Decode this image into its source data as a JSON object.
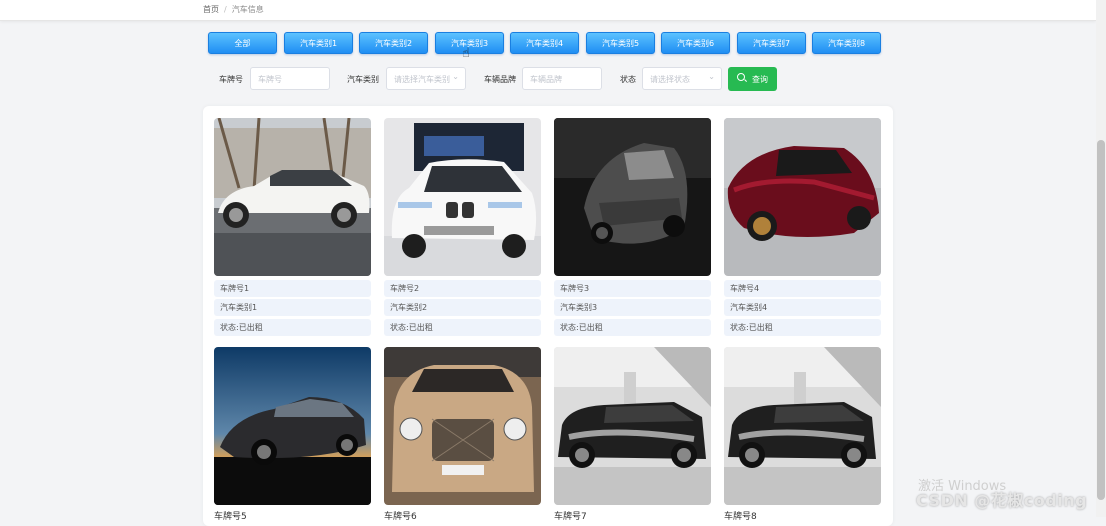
{
  "breadcrumb": {
    "home": "首页",
    "current": "汽车信息"
  },
  "tabs": [
    "全部",
    "汽车类别1",
    "汽车类别2",
    "汽车类别3",
    "汽车类别4",
    "汽车类别5",
    "汽车类别6",
    "汽车类别7",
    "汽车类别8"
  ],
  "filters": {
    "plate_label": "车牌号",
    "plate_placeholder": "车牌号",
    "category_label": "汽车类别",
    "category_placeholder": "请选择汽车类别",
    "brand_label": "车辆品牌",
    "brand_placeholder": "车辆品牌",
    "status_label": "状态",
    "status_placeholder": "请选择状态",
    "search_label": "查询"
  },
  "cars": [
    {
      "plate": "车牌号1",
      "category": "汽车类别1",
      "status": "状态:已出租"
    },
    {
      "plate": "车牌号2",
      "category": "汽车类别2",
      "status": "状态:已出租"
    },
    {
      "plate": "车牌号3",
      "category": "汽车类别3",
      "status": "状态:已出租"
    },
    {
      "plate": "车牌号4",
      "category": "汽车类别4",
      "status": "状态:已出租"
    },
    {
      "plate": "车牌号5"
    },
    {
      "plate": "车牌号6"
    },
    {
      "plate": "车牌号7"
    },
    {
      "plate": "车牌号8"
    }
  ],
  "overlay": {
    "windows": "激活 Windows",
    "csdn": "CSDN @花椒coding"
  },
  "colors": {
    "tab_primary": "#1f8ef3",
    "search_button": "#27ba52",
    "info_bg": "#eef3fb"
  }
}
